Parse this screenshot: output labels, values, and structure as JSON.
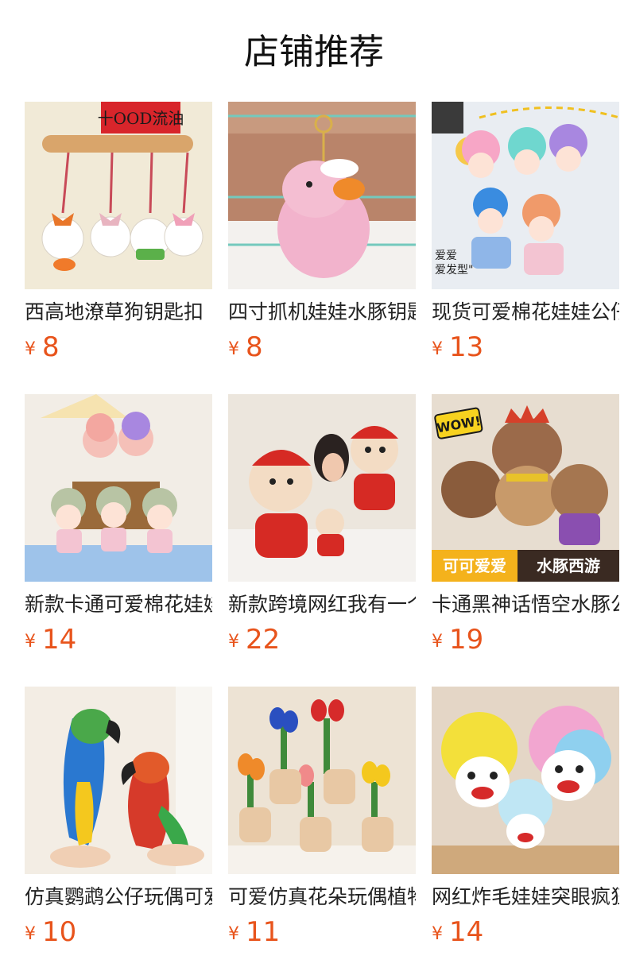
{
  "section_title": "店铺推荐",
  "currency_symbol": "¥",
  "accent_color": "#e8541c",
  "products": [
    {
      "name": "西高地潦草狗钥匙扣",
      "price": "8",
      "banner": "十OOD流油"
    },
    {
      "name": "四寸抓机娃娃水豚钥匙",
      "price": "8"
    },
    {
      "name": "现货可爱棉花娃娃公仔",
      "price": "13",
      "caption": "爱爱\n爱发型"
    },
    {
      "name": "新款卡通可爱棉花娃娃",
      "price": "14"
    },
    {
      "name": "新款跨境网红我有一个",
      "price": "22"
    },
    {
      "name": "卡通黑神话悟空水豚公仔",
      "price": "19",
      "badge": "WOW!",
      "tag_left": "可可爱爱",
      "tag_right": "水豚西游"
    },
    {
      "name": "仿真鹦鹉公仔玩偶可爱",
      "price": "10"
    },
    {
      "name": "可爱仿真花朵玩偶植物",
      "price": "11"
    },
    {
      "name": "网红炸毛娃娃突眼疯狂",
      "price": "14"
    }
  ]
}
